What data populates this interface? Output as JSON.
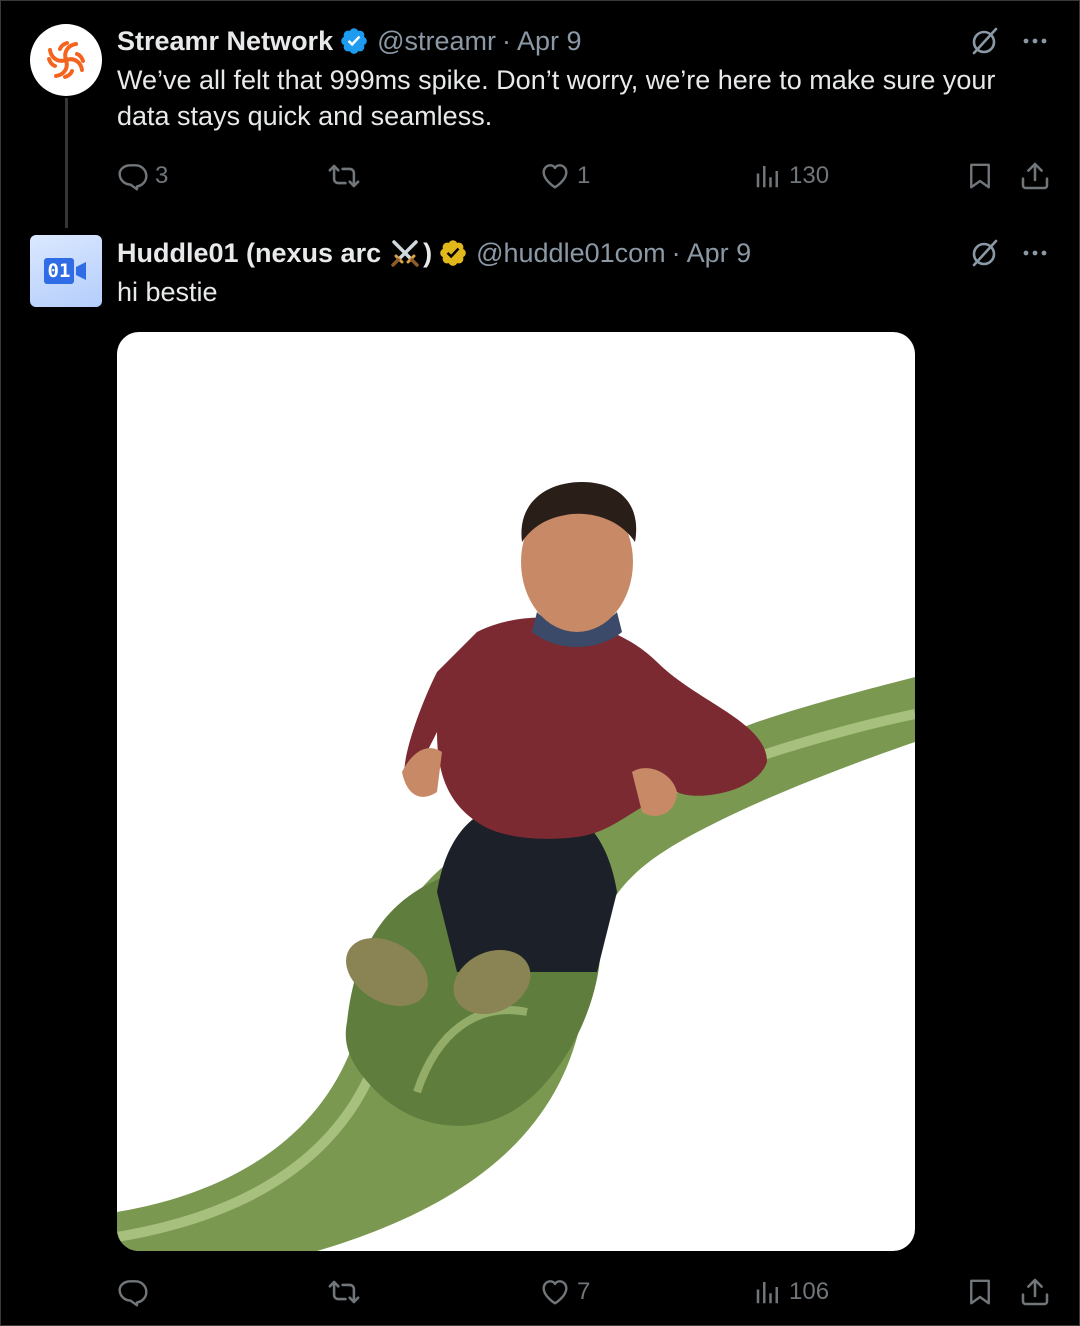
{
  "tweets": [
    {
      "name": "Streamr Network",
      "verified": "blue-check",
      "handle": "@streamr",
      "separator": "·",
      "date": "Apr 9",
      "text": "We’ve all felt that 999ms spike.  Don’t worry, we’re here to make sure your data stays quick and seamless.",
      "stats": {
        "replies": "3",
        "retweets": "",
        "likes": "1",
        "views": "130"
      },
      "avatar_icon": "streamr-logo-icon"
    },
    {
      "name": "Huddle01 (nexus arc",
      "name_emoji": "crossed-swords-icon",
      "name_suffix": ")",
      "verified": "gold-check",
      "handle": "@huddle01com",
      "separator": "·",
      "date": "Apr 9",
      "text": "hi bestie",
      "avatar_text": "01",
      "media": "photo of a man riding down a green playground slide",
      "stats": {
        "replies": "",
        "retweets": "",
        "likes": "7",
        "views": "106"
      }
    }
  ],
  "colors": {
    "background": "#000000",
    "text_primary": "#e7e9ea",
    "text_secondary": "#71767b",
    "verified_blue": "#1d9bf0",
    "verified_gold": "#e2b719",
    "streamr_orange": "#f5641e",
    "slide_green": "#7a9850"
  }
}
